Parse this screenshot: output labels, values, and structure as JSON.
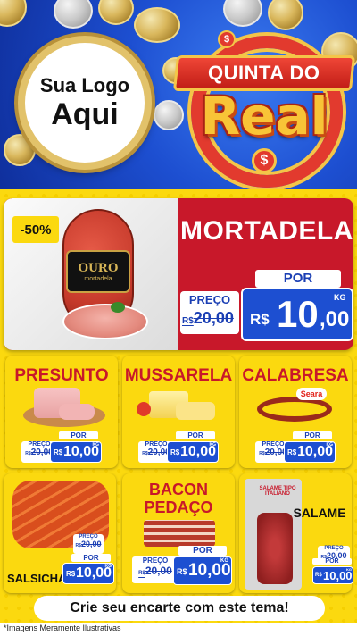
{
  "header": {
    "logo_line1": "Sua Logo",
    "logo_line2": "Aqui",
    "campaign_top": "QUINTA DO",
    "campaign_big": "Real",
    "currency_symbol": "$"
  },
  "colors": {
    "yellow": "#fbd90f",
    "red": "#c8182a",
    "blue": "#1d4fd1"
  },
  "featured": {
    "discount": "-50%",
    "name": "MORTADELA",
    "brand_on_pack": "OURO",
    "brand_sub": "mortadela",
    "preco_label": "PREÇO",
    "old_prefix": "R$",
    "old_price": "20,00",
    "por_label": "POR",
    "currency": "R$",
    "new_price_int": "10",
    "new_price_dec": ",00",
    "unit": "KG"
  },
  "products": [
    {
      "name": "PRESUNTO",
      "preco_label": "PREÇO",
      "old_price": "20,00",
      "old_prefix": "R$",
      "por_label": "POR",
      "currency": "R$",
      "price": "10,00",
      "unit": "KG"
    },
    {
      "name": "MUSSARELA",
      "preco_label": "PREÇO",
      "old_price": "20,00",
      "old_prefix": "R$",
      "por_label": "POR",
      "currency": "R$",
      "price": "10,00",
      "unit": "KG"
    },
    {
      "name": "CALABRESA",
      "brand": "Seara",
      "preco_label": "PREÇO",
      "old_price": "20,00",
      "old_prefix": "R$",
      "por_label": "POR",
      "currency": "R$",
      "price": "10,00",
      "unit": "KG"
    },
    {
      "name": "SALSICHA",
      "preco_label": "PREÇO",
      "old_price": "20,00",
      "old_prefix": "R$",
      "por_label": "POR",
      "currency": "R$",
      "price": "10,00",
      "unit": "KG"
    },
    {
      "name_line1": "BACON",
      "name_line2": "PEDAÇO",
      "preco_label": "PREÇO",
      "old_price": "20,00",
      "old_prefix": "R$",
      "por_label": "POR",
      "currency": "R$",
      "price": "10,00",
      "unit": "KG"
    },
    {
      "name": "SALAME",
      "pack_text": "SALAME TIPO ITALIANO",
      "preco_label": "PREÇO",
      "old_price": "20,00",
      "old_prefix": "R$",
      "por_label": "POR",
      "currency": "R$",
      "price": "10,00",
      "unit": "KG"
    }
  ],
  "footer": {
    "cta": "Crie seu encarte com este tema!",
    "disclaimer": "*Imagens Meramente Ilustrativas"
  }
}
